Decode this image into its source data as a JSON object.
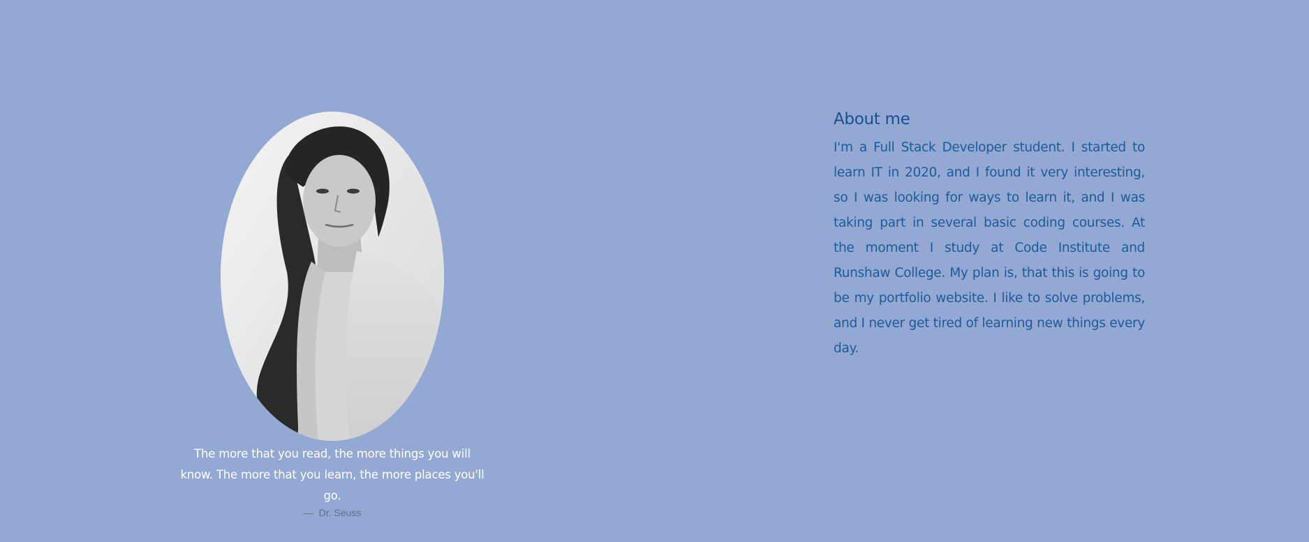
{
  "about": {
    "title": "About me",
    "body": "I'm a Full Stack Developer student. I started to learn IT in 2020, and I found it very interesting, so I was looking for ways to learn it, and I was taking part in several basic coding courses. At the moment I study at Code Institute and Runshaw College. My plan is, that this is going to be my portfolio website. I like to solve problems, and I never get tired of learning new things every day."
  },
  "quote": {
    "text": "The more that you read, the more things you will know. The more that you learn, the more places you'll go.",
    "dash": "—",
    "author": "Dr. Seuss"
  },
  "colors": {
    "background": "#93a9d3",
    "heading": "#1a4f8f",
    "body_text": "#1d5a9a",
    "quote_text": "#ffffff",
    "quote_author": "#5e6f8c"
  }
}
